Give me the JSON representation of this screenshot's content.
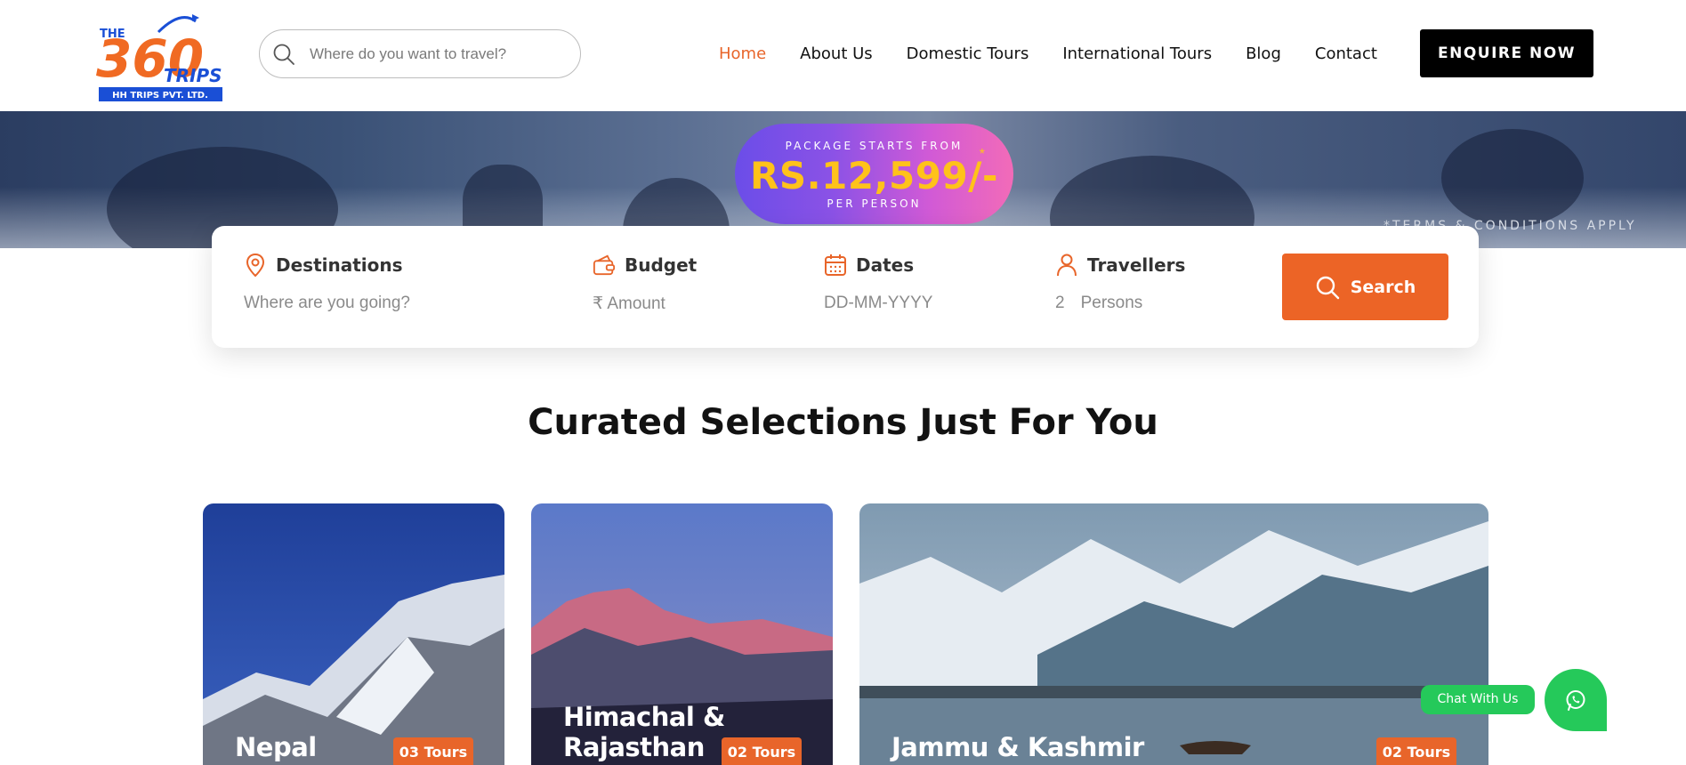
{
  "logo": {
    "line1": "THE",
    "line2": "360",
    "line3": "TRIPS",
    "company": "HH TRIPS PVT. LTD."
  },
  "search": {
    "placeholder": "Where do you want to travel?",
    "icon": "search-icon"
  },
  "nav": {
    "items": [
      {
        "label": "Home",
        "active": true
      },
      {
        "label": "About Us"
      },
      {
        "label": "Domestic Tours"
      },
      {
        "label": "International Tours"
      },
      {
        "label": "Blog"
      },
      {
        "label": "Contact"
      }
    ]
  },
  "enquire": {
    "label": "ENQUIRE NOW"
  },
  "hero": {
    "badge_top": "PACKAGE STARTS FROM",
    "price": "RS.12,599/-",
    "badge_bottom": "PER PERSON",
    "star": "*",
    "terms": "*TERMS & CONDITIONS APPLY"
  },
  "booking": {
    "destinations": {
      "label": "Destinations",
      "value": "Where are you going?",
      "icon": "location-pin-icon"
    },
    "budget": {
      "label": "Budget",
      "value": "₹ Amount",
      "icon": "wallet-icon"
    },
    "dates": {
      "label": "Dates",
      "value": "DD-MM-YYYY",
      "icon": "calendar-icon"
    },
    "travellers": {
      "label": "Travellers",
      "count": "2",
      "unit": "Persons",
      "icon": "person-icon"
    },
    "search_button": "Search"
  },
  "section": {
    "title": "Curated Selections Just For You"
  },
  "cards": [
    {
      "name": "Nepal",
      "tours": "03 Tours"
    },
    {
      "name_line1": "Himachal &",
      "name_line2": "Rajasthan",
      "tours": "02 Tours"
    },
    {
      "name": "Jammu & Kashmir",
      "tours": "02 Tours"
    }
  ],
  "chat": {
    "label": "Chat With Us",
    "icon": "whatsapp-icon"
  },
  "colors": {
    "accent": "#e8652a",
    "button": "#ec6426",
    "chat": "#25c95a",
    "price": "#ffc21a"
  }
}
